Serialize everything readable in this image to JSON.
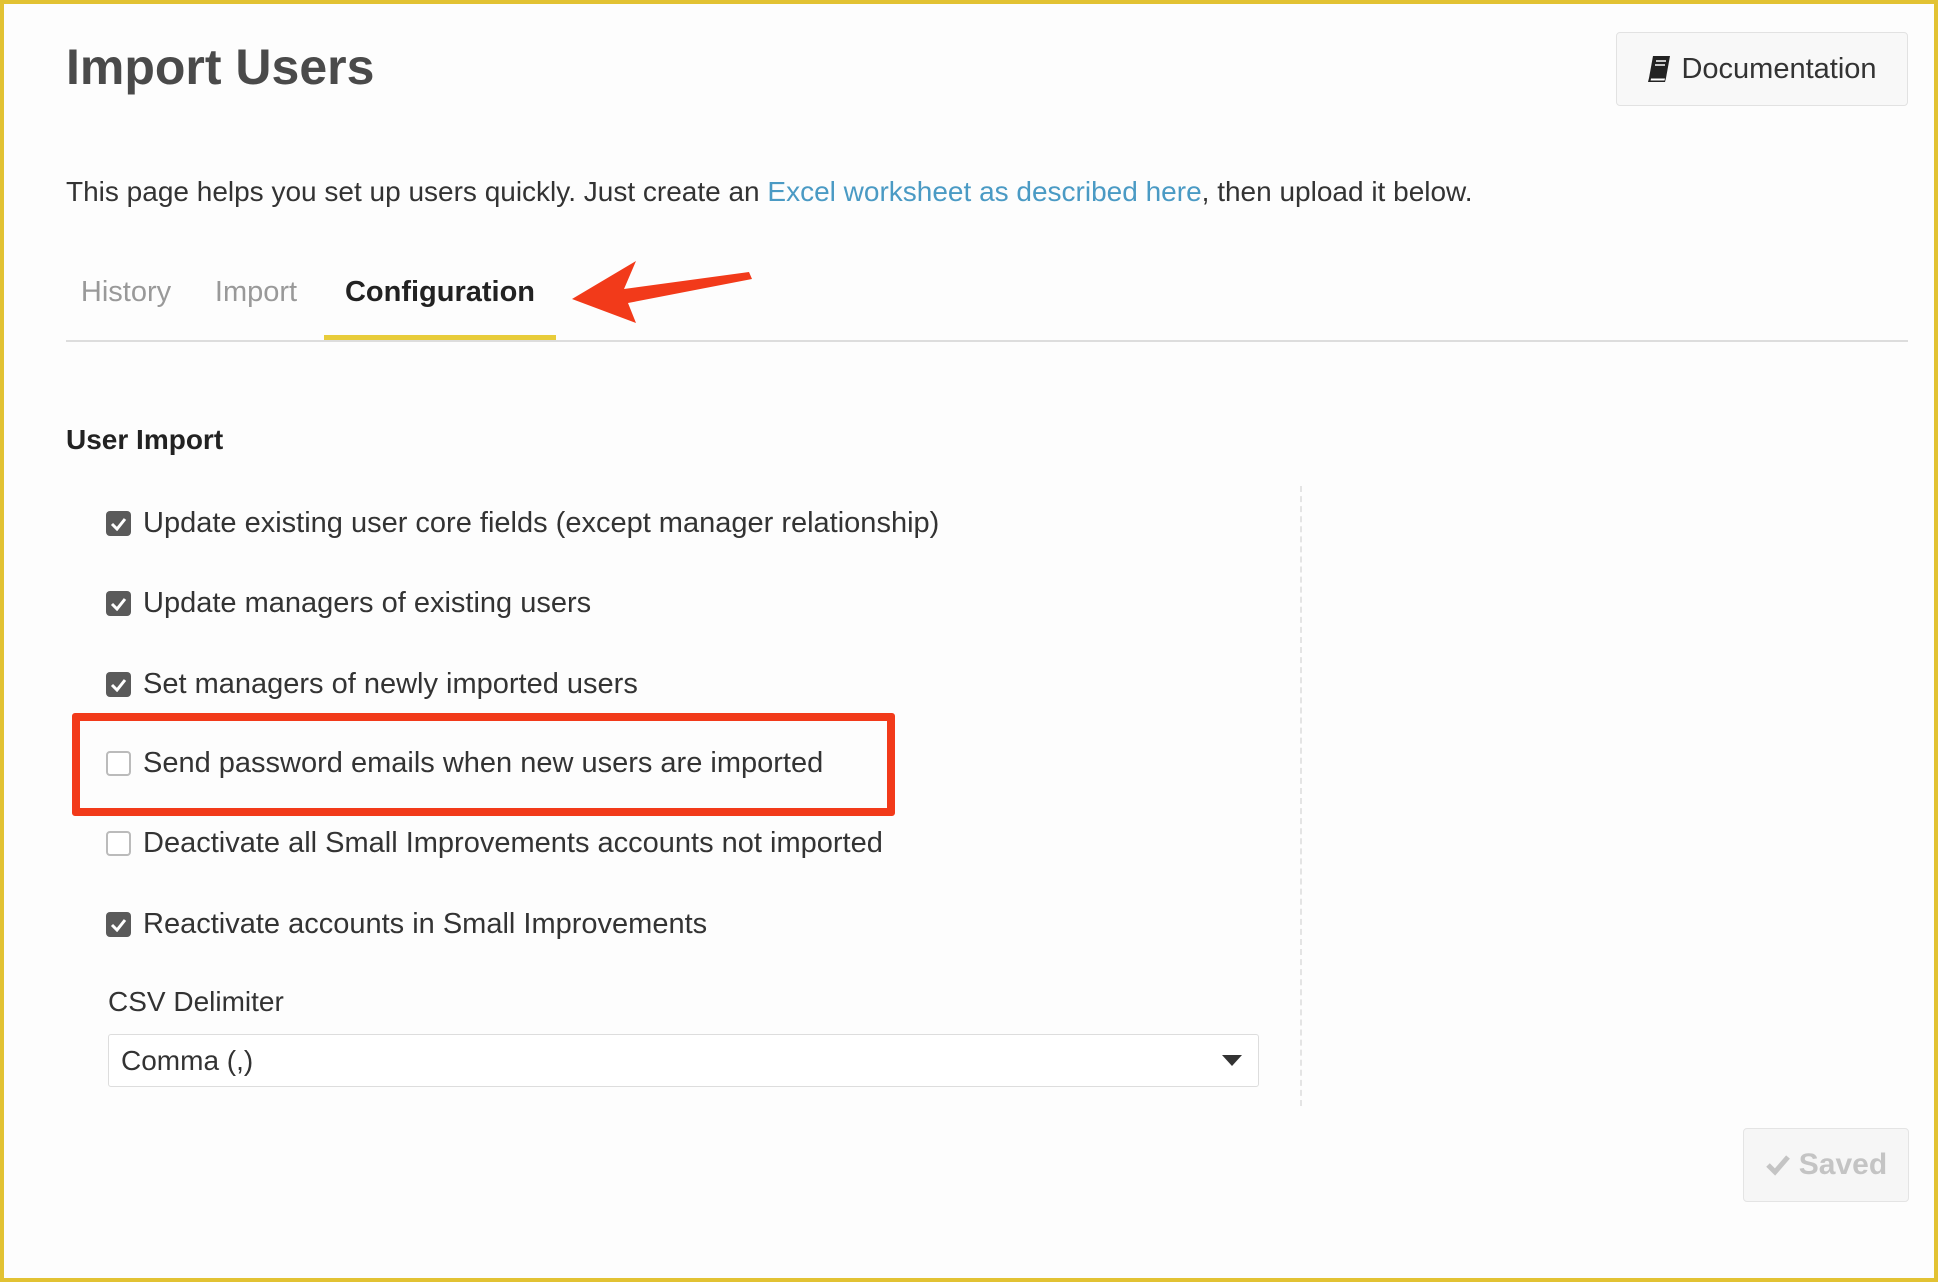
{
  "header": {
    "title": "Import Users",
    "doc_button": "Documentation",
    "doc_icon": "book-icon"
  },
  "description": {
    "before": "This page helps you set up users quickly. Just create an ",
    "link": "Excel worksheet as described here",
    "after": ", then upload it below."
  },
  "tabs": [
    {
      "label": "History",
      "active": false
    },
    {
      "label": "Import",
      "active": false
    },
    {
      "label": "Configuration",
      "active": true
    }
  ],
  "section": {
    "title": "User Import"
  },
  "options": [
    {
      "label": "Update existing user core fields (except manager relationship)",
      "checked": true
    },
    {
      "label": "Update managers of existing users",
      "checked": true
    },
    {
      "label": "Set managers of newly imported users",
      "checked": true
    },
    {
      "label": "Send password emails when new users are imported",
      "checked": false,
      "highlighted": true
    },
    {
      "label": "Deactivate all Small Improvements accounts not imported",
      "checked": false
    },
    {
      "label": "Reactivate accounts in Small Improvements",
      "checked": true
    }
  ],
  "csv": {
    "label": "CSV Delimiter",
    "selected": "Comma (,)"
  },
  "saved_button": {
    "label": "Saved",
    "icon": "check-icon"
  },
  "colors": {
    "accent": "#e8cc3a",
    "link": "#4a9ac4",
    "annotation": "#f23a1a",
    "frame": "#e2c233"
  }
}
